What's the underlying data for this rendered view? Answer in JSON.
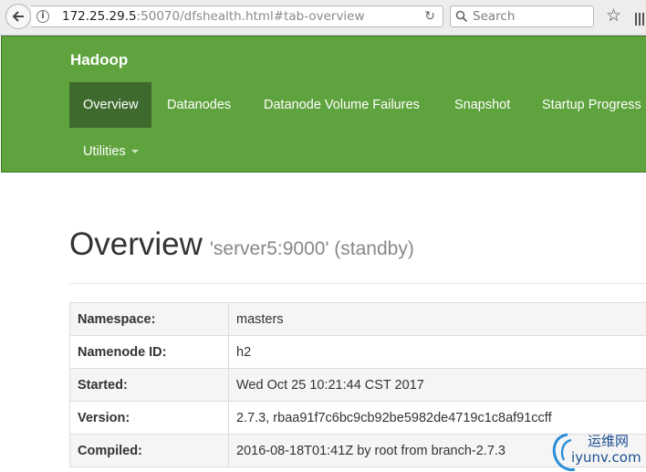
{
  "browser": {
    "url_host": "172.25.29.5",
    "url_rest": ":50070/dfshealth.html#tab-overview",
    "search_placeholder": "Search"
  },
  "navbar": {
    "brand": "Hadoop",
    "items": [
      {
        "label": "Overview",
        "active": true
      },
      {
        "label": "Datanodes"
      },
      {
        "label": "Datanode Volume Failures"
      },
      {
        "label": "Snapshot"
      },
      {
        "label": "Startup Progress"
      },
      {
        "label": "Utilities"
      }
    ],
    "accent": "#5fa33e",
    "active_bg": "#3e6b2d"
  },
  "overview": {
    "title": "Overview",
    "subtitle": "'server5:9000' (standby)",
    "rows": [
      {
        "key": "Namespace:",
        "value": "masters"
      },
      {
        "key": "Namenode ID:",
        "value": "h2"
      },
      {
        "key": "Started:",
        "value": "Wed Oct 25 10:21:44 CST 2017"
      },
      {
        "key": "Version:",
        "value": "2.7.3, rbaa91f7c6bc9cb92be5982de4719c1c8af91ccff"
      },
      {
        "key": "Compiled:",
        "value": "2016-08-18T01:41Z by root from branch-2.7.3"
      }
    ]
  },
  "watermark": {
    "cn": "运维网",
    "en": "iyunv.com"
  }
}
